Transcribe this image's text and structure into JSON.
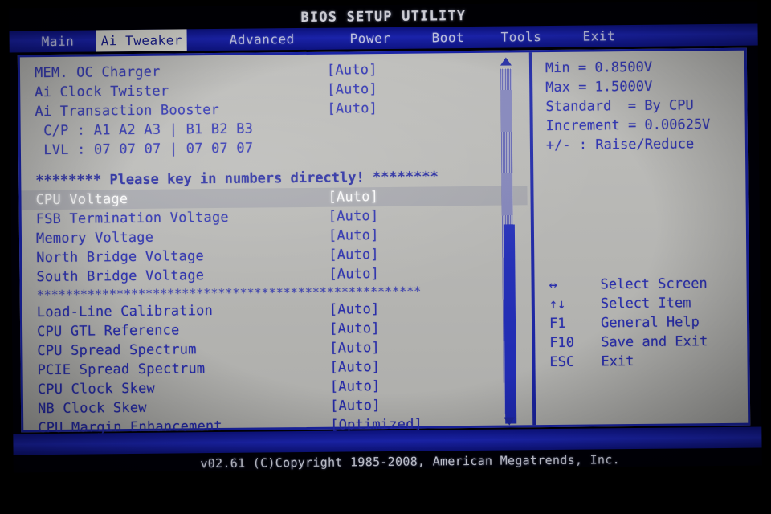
{
  "window": {
    "title": "BIOS SETUP UTILITY"
  },
  "menu": {
    "tabs": [
      {
        "label": "Main",
        "active": false
      },
      {
        "label": "Ai Tweaker",
        "active": true
      },
      {
        "label": "Advanced",
        "active": false
      },
      {
        "label": "Power",
        "active": false
      },
      {
        "label": "Boot",
        "active": false
      },
      {
        "label": "Tools",
        "active": false
      },
      {
        "label": "Exit",
        "active": false
      }
    ]
  },
  "settings": {
    "rows": [
      {
        "kind": "item",
        "label": "MEM. OC Charger",
        "value": "[Auto]",
        "selected": false
      },
      {
        "kind": "item",
        "label": "Ai Clock Twister",
        "value": "[Auto]",
        "selected": false
      },
      {
        "kind": "item",
        "label": "Ai Transaction Booster",
        "value": "[Auto]",
        "selected": false
      },
      {
        "kind": "plain",
        "label": " C/P : A1 A2 A3 | B1 B2 B3",
        "value": "",
        "selected": false
      },
      {
        "kind": "plain",
        "label": " LVL : 07 07 07 | 07 07 07",
        "value": "",
        "selected": false
      },
      {
        "kind": "spacer",
        "label": "",
        "value": "",
        "selected": false
      },
      {
        "kind": "banner",
        "label": "******** Please key in numbers directly! ********",
        "value": "",
        "selected": false
      },
      {
        "kind": "item",
        "label": "CPU Voltage",
        "value": "[Auto]",
        "selected": true
      },
      {
        "kind": "item",
        "label": "FSB Termination Voltage",
        "value": "[Auto]",
        "selected": false
      },
      {
        "kind": "item",
        "label": "Memory Voltage",
        "value": "[Auto]",
        "selected": false
      },
      {
        "kind": "item",
        "label": "North Bridge Voltage",
        "value": "[Auto]",
        "selected": false
      },
      {
        "kind": "item",
        "label": "South Bridge Voltage",
        "value": "[Auto]",
        "selected": false
      },
      {
        "kind": "sep",
        "label": "*****************************************************",
        "value": "",
        "selected": false
      },
      {
        "kind": "item",
        "label": "Load-Line Calibration",
        "value": "[Auto]",
        "selected": false
      },
      {
        "kind": "item",
        "label": "CPU GTL Reference",
        "value": "[Auto]",
        "selected": false
      },
      {
        "kind": "item",
        "label": "CPU Spread Spectrum",
        "value": "[Auto]",
        "selected": false
      },
      {
        "kind": "item",
        "label": "PCIE Spread Spectrum",
        "value": "[Auto]",
        "selected": false
      },
      {
        "kind": "item",
        "label": "CPU Clock Skew",
        "value": "[Auto]",
        "selected": false
      },
      {
        "kind": "item",
        "label": "NB Clock Skew",
        "value": "[Auto]",
        "selected": false
      },
      {
        "kind": "item",
        "label": "CPU Margin Enhancement",
        "value": "[Optimized]",
        "selected": false
      }
    ]
  },
  "scrollbar": {
    "up_arrow": "scroll-up-arrow",
    "down_arrow": "scroll-down-arrow"
  },
  "help": {
    "lines": [
      "Min = 0.8500V",
      "Max = 1.5000V",
      "Standard  = By CPU",
      "Increment = 0.00625V",
      "+/- : Raise/Reduce"
    ],
    "keys": [
      {
        "key": "↔",
        "desc": "Select Screen"
      },
      {
        "key": "↑↓",
        "desc": "Select Item"
      },
      {
        "key": "F1",
        "desc": "General Help"
      },
      {
        "key": "F10",
        "desc": "Save and Exit"
      },
      {
        "key": "ESC",
        "desc": "Exit"
      }
    ]
  },
  "footer": {
    "text": "v02.61 (C)Copyright 1985-2008, American Megatrends, Inc."
  },
  "colors": {
    "menu_blue": "#141b9e",
    "text_blue": "#262bb0",
    "panel_gray": "#b9b9b6",
    "border_blue": "#1a24a8",
    "selected_white": "#ffffff",
    "scroll_thumb": "#1f2bbb"
  }
}
